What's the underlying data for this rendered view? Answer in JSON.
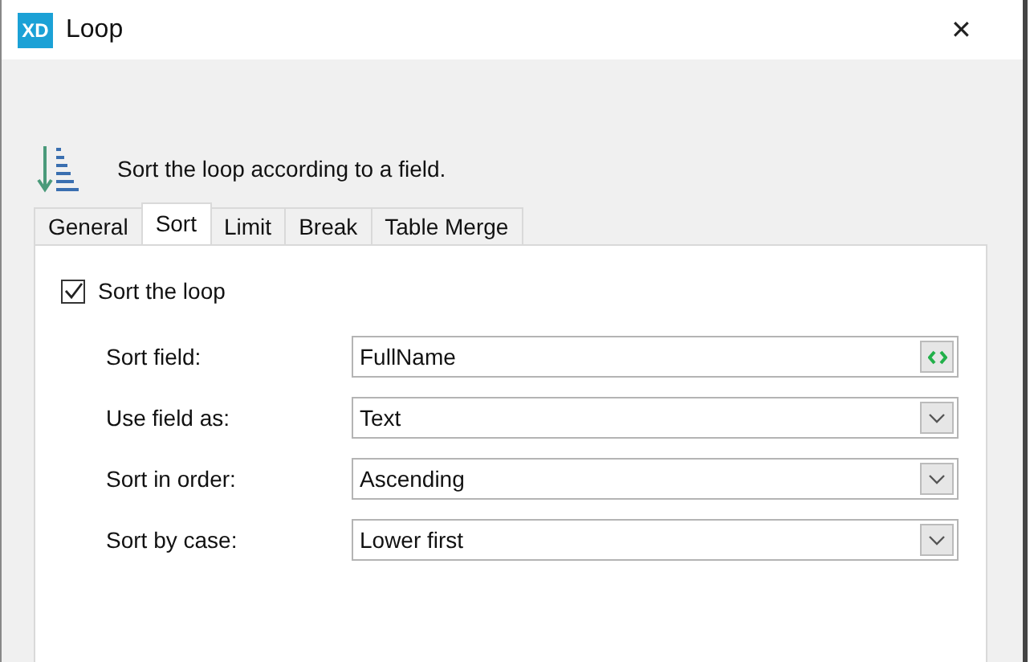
{
  "window": {
    "logo": "XD",
    "title": "Loop",
    "close": "✕"
  },
  "header": {
    "description": "Sort the loop according to a field."
  },
  "tabs": [
    {
      "label": "General",
      "selected": false
    },
    {
      "label": "Sort",
      "selected": true
    },
    {
      "label": "Limit",
      "selected": false
    },
    {
      "label": "Break",
      "selected": false
    },
    {
      "label": "Table Merge",
      "selected": false
    }
  ],
  "sort": {
    "checkbox": {
      "label": "Sort the loop",
      "checked": true
    },
    "fields": [
      {
        "label": "Sort field:",
        "value": "FullName",
        "kind": "text"
      },
      {
        "label": "Use field as:",
        "value": "Text",
        "kind": "dropdown"
      },
      {
        "label": "Sort in order:",
        "value": "Ascending",
        "kind": "dropdown"
      },
      {
        "label": "Sort by case:",
        "value": "Lower first",
        "kind": "dropdown"
      }
    ]
  }
}
